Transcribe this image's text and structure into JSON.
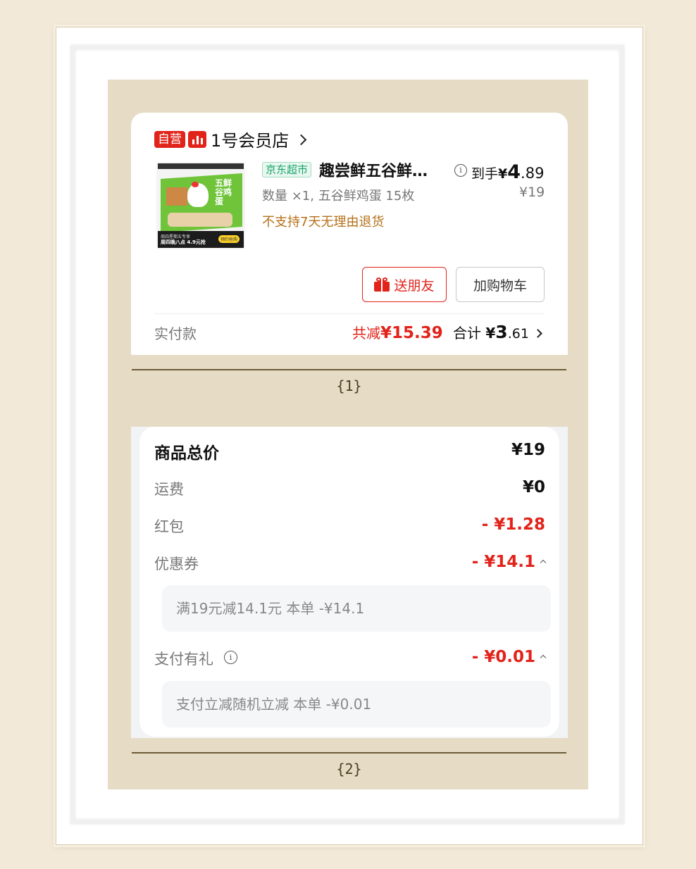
{
  "store": {
    "badge": "自营",
    "icon": "store-chart-icon",
    "name": "1号会员店"
  },
  "product": {
    "channel_tag": "京东超市",
    "title": "趣尝鲜五谷鲜…",
    "spec": "数量 ×1, 五谷鲜鸡蛋 15枚",
    "notice": "不支持7天无理由退货",
    "price_prefix": "到手",
    "price_symbol": "¥",
    "price_int": "4",
    "price_dec": ".89",
    "original_price": "¥19",
    "image": {
      "box_label_line1": "五鲜",
      "box_label_line2": "谷鸡",
      "box_label_line3": "蛋",
      "promo_line1": "周四星期五专享",
      "promo_line2": "周四晚八点 4.9元抢",
      "promo_button": "预约抢购"
    }
  },
  "actions": {
    "gift_label": "送朋友",
    "cart_label": "加购物车"
  },
  "payment": {
    "label": "实付款",
    "discount_prefix": "共减",
    "discount_value": "¥15.39",
    "total_prefix": "合计",
    "total_symbol": "¥",
    "total_int": "3",
    "total_dec": ".61"
  },
  "captions": {
    "first": "{1}",
    "second": "{2}"
  },
  "breakdown": {
    "goods_total_label": "商品总价",
    "goods_total_value": "¥19",
    "shipping_label": "运费",
    "shipping_value": "¥0",
    "redpacket_label": "红包",
    "redpacket_value": "- ¥1.28",
    "coupon_label": "优惠券",
    "coupon_value": "- ¥14.1",
    "coupon_detail": "满19元减14.1元   本单 -¥14.1",
    "paygift_label": "支付有礼",
    "paygift_value": "- ¥0.01",
    "paygift_detail": "支付立减随机立减   本单 -¥0.01"
  },
  "colors": {
    "accent_red": "#e2231a",
    "warning_orange": "#b5701a",
    "jd_green": "#19a56a",
    "mat": "#e6dcc6"
  }
}
